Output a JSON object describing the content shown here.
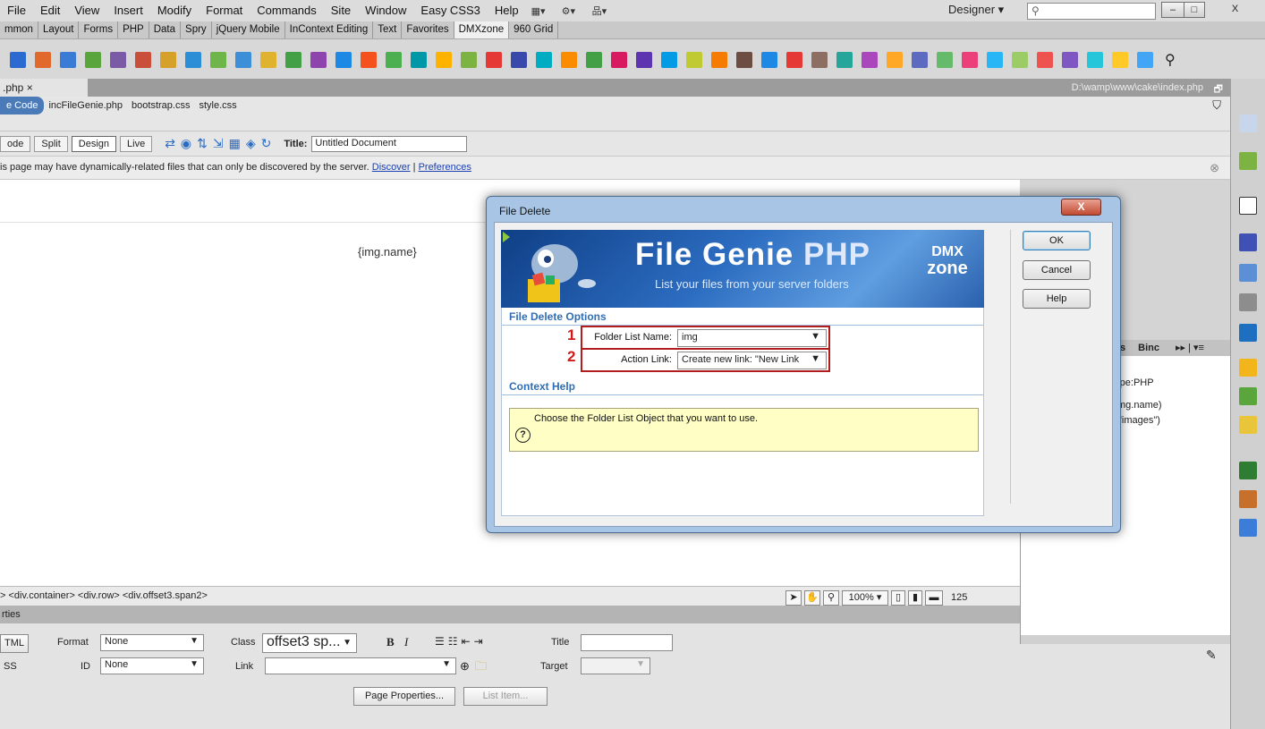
{
  "menu": {
    "items": [
      "File",
      "Edit",
      "View",
      "Insert",
      "Modify",
      "Format",
      "Commands",
      "Site",
      "Window",
      "Easy CSS3",
      "Help"
    ],
    "workspace": "Designer",
    "window_buttons": {
      "minimize": "–",
      "restore": "□",
      "close": "X"
    }
  },
  "insert_tabs": [
    "mmon",
    "Layout",
    "Forms",
    "PHP",
    "Data",
    "Spry",
    "jQuery Mobile",
    "InContext Editing",
    "Text",
    "Favorites",
    "DMXzone",
    "960 Grid"
  ],
  "insert_active": "DMXzone",
  "toolbar_colors": [
    "#2a6ad1",
    "#e2692c",
    "#3a7bd5",
    "#5aa53c",
    "#7b5aa6",
    "#c94f3a",
    "#d6a12a",
    "#2b8ed6",
    "#6fb64a",
    "#3d8fd8",
    "#e0b32f",
    "#43a047",
    "#8e44ad",
    "#1e88e5",
    "#f4511e",
    "#4caf50",
    "#0097a7",
    "#ffb300",
    "#7cb342",
    "#e53935",
    "#3949ab",
    "#00acc1",
    "#fb8c00",
    "#43a047",
    "#d81b60",
    "#5e35b1",
    "#039be5",
    "#c0ca33",
    "#f57c00",
    "#6d4c41",
    "#1e88e5",
    "#e53935",
    "#8d6e63",
    "#26a69a",
    "#ab47bc",
    "#ffa726",
    "#5c6bc0",
    "#66bb6a",
    "#ec407a",
    "#29b6f6",
    "#9ccc65",
    "#ef5350",
    "#7e57c2",
    "#26c6da",
    "#ffca28",
    "#42a5f5"
  ],
  "document": {
    "tab": ".php ×",
    "path": "D:\\wamp\\www\\cake\\index.php",
    "related_files": [
      "e Code",
      "incFileGenie.php",
      "bootstrap.css",
      "style.css"
    ],
    "view_buttons": [
      "ode",
      "Split",
      "Design",
      "Live"
    ],
    "active_view": "Design",
    "title_label": "Title:",
    "title_value": "Untitled Document",
    "info_text": "is page may have dynamically-related files that can only be discovered by the server.",
    "info_discover": "Discover",
    "info_sep": "|",
    "info_prefs": "Preferences",
    "canvas_text": "{img.name}"
  },
  "tag_selector": {
    "path": "> <div.container> <div.row> <div.offset3.span2>",
    "zoom": "100%",
    "size": "125"
  },
  "properties": {
    "header": "rties",
    "html_btn": "TML",
    "css_btn": "SS",
    "format_label": "Format",
    "format_value": "None",
    "class_label": "Class",
    "class_value": "offset3 sp...",
    "id_label": "ID",
    "id_value": "None",
    "link_label": "Link",
    "title_label": "Title",
    "target_label": "Target",
    "page_props_btn": "Page Properties...",
    "list_item_btn": "List Item..."
  },
  "right_panel": {
    "tabs": [
      "ors",
      "Binc"
    ],
    "doc_type": "t type:PHP",
    "lines": [
      "mg.name)",
      "\"images\")"
    ]
  },
  "dialog": {
    "title": "File Delete",
    "close": "X",
    "banner_title_a": "File Genie",
    "banner_title_b": "PHP",
    "banner_sub": "List your files from your server folders",
    "banner_logo_a": "DMX",
    "banner_logo_b": "zone",
    "section_options": "File Delete Options",
    "num1": "1",
    "num2": "2",
    "folder_label": "Folder List Name:",
    "folder_value": "img",
    "action_label": "Action Link:",
    "action_value": "Create new link: \"New Link",
    "section_help": "Context Help",
    "help_text": "Choose the Folder List Object that you want to use.",
    "ok": "OK",
    "cancel": "Cancel",
    "help": "Help"
  }
}
